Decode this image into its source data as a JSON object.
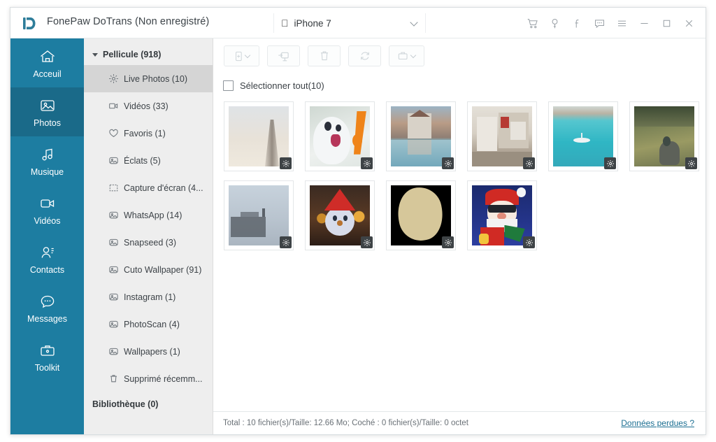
{
  "window": {
    "brand_title": "FonePaw DoTrans (Non enregistré)",
    "logo_icon": "fonepaw-logo-icon",
    "accent_color": "#1d7da1",
    "accent_active_color": "#1a6a89"
  },
  "device": {
    "platform_icon": "apple-icon",
    "name": "iPhone 7",
    "dropdown_icon": "chevron-down-icon"
  },
  "titlebar_icons": [
    {
      "name": "cart-icon",
      "label": "Panier"
    },
    {
      "name": "key-icon",
      "label": "Clé d'enregistrement"
    },
    {
      "name": "facebook-icon",
      "label": "Facebook"
    },
    {
      "name": "feedback-icon",
      "label": "Commentaires"
    },
    {
      "name": "menu-icon",
      "label": "Menu"
    },
    {
      "name": "minimize-icon",
      "label": "Réduire"
    },
    {
      "name": "maximize-icon",
      "label": "Agrandir"
    },
    {
      "name": "close-icon",
      "label": "Fermer"
    }
  ],
  "sidebar": {
    "items": [
      {
        "label": "Acceuil",
        "icon": "home-icon",
        "active": false
      },
      {
        "label": "Photos",
        "icon": "photo-icon",
        "active": true
      },
      {
        "label": "Musique",
        "icon": "music-icon",
        "active": false
      },
      {
        "label": "Vidéos",
        "icon": "video-icon",
        "active": false
      },
      {
        "label": "Contacts",
        "icon": "contacts-icon",
        "active": false
      },
      {
        "label": "Messages",
        "icon": "messages-icon",
        "active": false
      },
      {
        "label": "Toolkit",
        "icon": "toolkit-icon",
        "active": false
      }
    ]
  },
  "tree": {
    "header": {
      "label": "Pellicule (918)",
      "caret_icon": "caret-down-icon"
    },
    "items": [
      {
        "label": "Live Photos (10)",
        "icon": "live-photos-icon",
        "selected": true
      },
      {
        "label": "Vidéos (33)",
        "icon": "video-icon",
        "selected": false
      },
      {
        "label": "Favoris (1)",
        "icon": "heart-icon",
        "selected": false
      },
      {
        "label": "Éclats (5)",
        "icon": "album-icon",
        "selected": false
      },
      {
        "label": "Capture d'écran (4...",
        "icon": "screenshot-icon",
        "selected": false
      },
      {
        "label": "WhatsApp (14)",
        "icon": "album-icon",
        "selected": false
      },
      {
        "label": "Snapseed (3)",
        "icon": "album-icon",
        "selected": false
      },
      {
        "label": "Cuto Wallpaper (91)",
        "icon": "album-icon",
        "selected": false
      },
      {
        "label": "Instagram (1)",
        "icon": "album-icon",
        "selected": false
      },
      {
        "label": "PhotoScan (4)",
        "icon": "album-icon",
        "selected": false
      },
      {
        "label": "Wallpapers (1)",
        "icon": "album-icon",
        "selected": false
      },
      {
        "label": "Supprimé récemm...",
        "icon": "trash-icon",
        "selected": false
      }
    ],
    "library_label": "Bibliothèque (0)"
  },
  "toolbar": {
    "buttons": [
      {
        "name": "add-to-device-button",
        "icon": "add-to-device-icon",
        "has_dropdown": true
      },
      {
        "name": "export-to-pc-button",
        "icon": "export-to-pc-icon",
        "has_dropdown": false
      },
      {
        "name": "delete-button",
        "icon": "trash-icon",
        "has_dropdown": false
      },
      {
        "name": "refresh-button",
        "icon": "refresh-icon",
        "has_dropdown": false
      },
      {
        "name": "toolkit-button",
        "icon": "toolkit-icon",
        "has_dropdown": true
      }
    ]
  },
  "selection": {
    "select_all_label": "Sélectionner tout(10)",
    "checked": false
  },
  "photos": [
    {
      "name": "eiffel-tower-photo",
      "badge_icon": "live-photo-badge-icon"
    },
    {
      "name": "rabbit-cartoon-photo",
      "badge_icon": "live-photo-badge-icon"
    },
    {
      "name": "canal-houses-photo",
      "badge_icon": "live-photo-badge-icon"
    },
    {
      "name": "street-shop-photo",
      "badge_icon": "live-photo-badge-icon"
    },
    {
      "name": "boat-sea-photo",
      "badge_icon": "live-photo-badge-icon"
    },
    {
      "name": "hillside-grass-photo",
      "badge_icon": "live-photo-badge-icon"
    },
    {
      "name": "foggy-rocks-photo",
      "badge_icon": "live-photo-badge-icon"
    },
    {
      "name": "snowman-photo",
      "badge_icon": "live-photo-badge-icon"
    },
    {
      "name": "dark-shape-photo",
      "badge_icon": "live-photo-badge-icon"
    },
    {
      "name": "santa-claus-photo",
      "badge_icon": "live-photo-badge-icon"
    }
  ],
  "statusbar": {
    "text": "Total : 10 fichier(s)/Taille: 12.66 Mo; Coché : 0 fichier(s)/Taille: 0 octet",
    "link": "Données perdues ?",
    "link_color": "#1c6f92"
  }
}
